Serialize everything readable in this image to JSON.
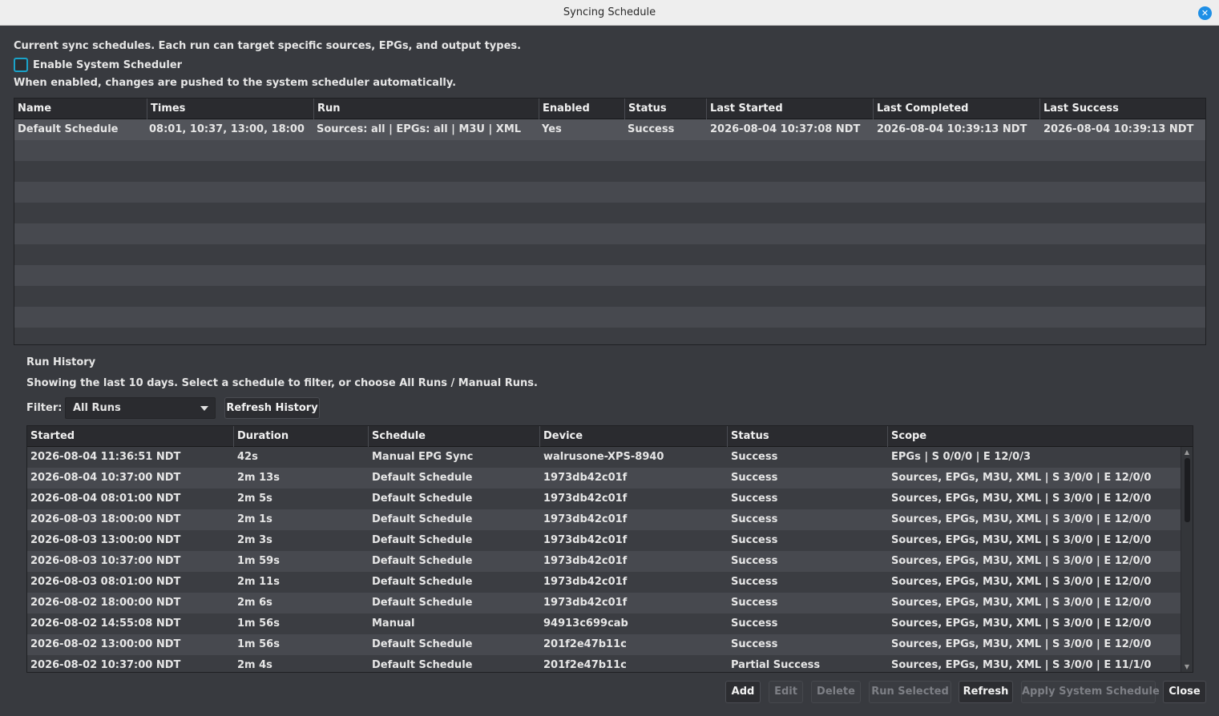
{
  "window": {
    "title": "Syncing Schedule"
  },
  "intro": {
    "description": "Current sync schedules. Each run can target specific sources, EPGs, and output types.",
    "enable_label": "Enable System Scheduler",
    "enable_checked": false,
    "hint": "When enabled, changes are pushed to the system scheduler automatically."
  },
  "schedules": {
    "columns": [
      "Name",
      "Times",
      "Run",
      "Enabled",
      "Status",
      "Last Started",
      "Last Completed",
      "Last Success"
    ],
    "rows": [
      [
        "Default Schedule",
        "08:01, 10:37, 13:00, 18:00",
        "Sources: all | EPGs: all | M3U | XML",
        "Yes",
        "Success",
        "2026-08-04 10:37:08 NDT",
        "2026-08-04 10:39:13 NDT",
        "2026-08-04 10:39:13 NDT"
      ]
    ]
  },
  "history": {
    "heading": "Run History",
    "description": "Showing the last 10 days. Select a schedule to filter, or choose All Runs / Manual Runs.",
    "filter_label": "Filter:",
    "filter_value": "All Runs",
    "refresh_label": "Refresh History",
    "columns": [
      "Started",
      "Duration",
      "Schedule",
      "Device",
      "Status",
      "Scope"
    ],
    "rows": [
      [
        "2026-08-04 11:36:51 NDT",
        "42s",
        "Manual EPG Sync",
        "walrusone-XPS-8940",
        "Success",
        "EPGs | S 0/0/0 | E 12/0/3"
      ],
      [
        "2026-08-04 10:37:00 NDT",
        "2m 13s",
        "Default Schedule",
        "1973db42c01f",
        "Success",
        "Sources, EPGs, M3U, XML | S 3/0/0 | E 12/0/0"
      ],
      [
        "2026-08-04 08:01:00 NDT",
        "2m 5s",
        "Default Schedule",
        "1973db42c01f",
        "Success",
        "Sources, EPGs, M3U, XML | S 3/0/0 | E 12/0/0"
      ],
      [
        "2026-08-03 18:00:00 NDT",
        "2m 1s",
        "Default Schedule",
        "1973db42c01f",
        "Success",
        "Sources, EPGs, M3U, XML | S 3/0/0 | E 12/0/0"
      ],
      [
        "2026-08-03 13:00:00 NDT",
        "2m 3s",
        "Default Schedule",
        "1973db42c01f",
        "Success",
        "Sources, EPGs, M3U, XML | S 3/0/0 | E 12/0/0"
      ],
      [
        "2026-08-03 10:37:00 NDT",
        "1m 59s",
        "Default Schedule",
        "1973db42c01f",
        "Success",
        "Sources, EPGs, M3U, XML | S 3/0/0 | E 12/0/0"
      ],
      [
        "2026-08-03 08:01:00 NDT",
        "2m 11s",
        "Default Schedule",
        "1973db42c01f",
        "Success",
        "Sources, EPGs, M3U, XML | S 3/0/0 | E 12/0/0"
      ],
      [
        "2026-08-02 18:00:00 NDT",
        "2m 6s",
        "Default Schedule",
        "1973db42c01f",
        "Success",
        "Sources, EPGs, M3U, XML | S 3/0/0 | E 12/0/0"
      ],
      [
        "2026-08-02 14:55:08 NDT",
        "1m 56s",
        "Manual",
        "94913c699cab",
        "Success",
        "Sources, EPGs, M3U, XML | S 3/0/0 | E 12/0/0"
      ],
      [
        "2026-08-02 13:00:00 NDT",
        "1m 56s",
        "Default Schedule",
        "201f2e47b11c",
        "Success",
        "Sources, EPGs, M3U, XML | S 3/0/0 | E 12/0/0"
      ],
      [
        "2026-08-02 10:37:00 NDT",
        "2m 4s",
        "Default Schedule",
        "201f2e47b11c",
        "Partial Success",
        "Sources, EPGs, M3U, XML | S 3/0/0 | E 11/1/0"
      ]
    ]
  },
  "buttons": {
    "add": "Add",
    "edit": "Edit",
    "delete": "Delete",
    "run_selected": "Run Selected",
    "refresh": "Refresh",
    "apply_system_schedule": "Apply System Schedule",
    "close": "Close"
  }
}
